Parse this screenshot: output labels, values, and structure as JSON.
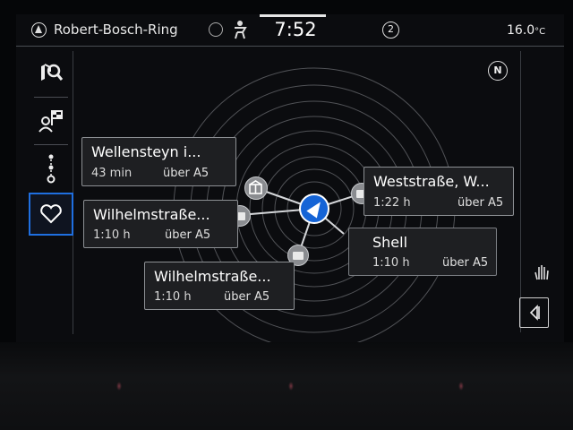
{
  "status_bar": {
    "location": "Robert-Bosch-Ring",
    "clock": "7:52",
    "badge_count": "2",
    "temperature": "16.0",
    "temperature_unit": "°C",
    "icons": [
      "navigation-arrow-icon",
      "globe-icon",
      "traffic-person-icon"
    ]
  },
  "left_menu": {
    "items": [
      {
        "name": "destination-search",
        "icon": "map-search-icon"
      },
      {
        "name": "contacts-destination",
        "icon": "person-flag-icon"
      },
      {
        "name": "route-stops",
        "icon": "route-icon"
      },
      {
        "name": "favorites",
        "icon": "heart-icon",
        "active": true
      }
    ]
  },
  "map": {
    "compass_label": "N",
    "center_icon": "vehicle-position-icon"
  },
  "destinations": [
    {
      "title": "Wellensteyn i...",
      "duration": "43 min",
      "via": "über A5",
      "icon": "gift-icon"
    },
    {
      "title": "Wilhelmstraße...",
      "duration": "1:10 h",
      "via": "über A5",
      "icon": "envelope-icon"
    },
    {
      "title": "Wilhelmstraße...",
      "duration": "1:10 h",
      "via": "über A5",
      "icon": "envelope-icon"
    },
    {
      "title": "Weststraße, W...",
      "duration": "1:22 h",
      "via": "über A5",
      "icon": "envelope-icon"
    },
    {
      "title": "Shell",
      "duration": "1:10 h",
      "via": "über A5",
      "icon": "shell-logo-icon"
    }
  ],
  "colors": {
    "accent": "#1f6fe0",
    "center_marker": "#1564d6",
    "shell_yellow": "#f5c400",
    "shell_red": "#d6221b"
  }
}
